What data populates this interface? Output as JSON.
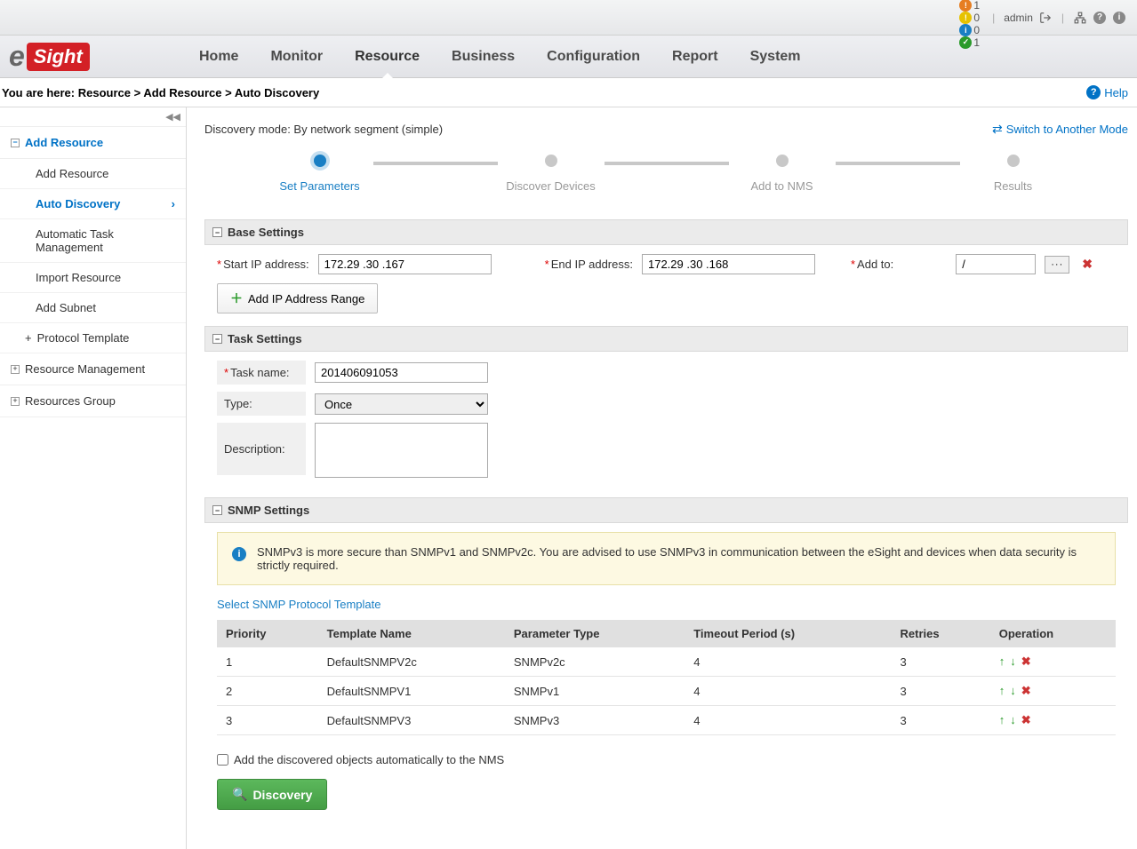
{
  "topbar": {
    "statuses": [
      {
        "color": "#d43f3a",
        "icon": "⟳",
        "count": "1"
      },
      {
        "color": "#e67e22",
        "icon": "!",
        "count": "1"
      },
      {
        "color": "#e6c200",
        "icon": "!",
        "count": "0"
      },
      {
        "color": "#197fc4",
        "icon": "i",
        "count": "0"
      },
      {
        "color": "#2a9a2a",
        "icon": "✓",
        "count": "1"
      }
    ],
    "user": "admin"
  },
  "nav": [
    "Home",
    "Monitor",
    "Resource",
    "Business",
    "Configuration",
    "Report",
    "System"
  ],
  "breadcrumb": {
    "prefix": "You are here:",
    "path1": "Resource",
    "path2": "Add Resource",
    "path3": "Auto Discovery",
    "help": "Help"
  },
  "sidebar": {
    "add_resource": "Add Resource",
    "add_resource_sub": "Add Resource",
    "auto_discovery": "Auto Discovery",
    "auto_task": "Automatic Task Management",
    "import_resource": "Import Resource",
    "add_subnet": "Add Subnet",
    "protocol_template": "Protocol Template",
    "resource_management": "Resource Management",
    "resources_group": "Resources Group"
  },
  "mode": {
    "label": "Discovery mode: By network segment (simple)",
    "switch": "Switch to Another Mode"
  },
  "wizard": [
    "Set Parameters",
    "Discover Devices",
    "Add to NMS",
    "Results"
  ],
  "base": {
    "header": "Base Settings",
    "start_ip_label": "Start IP address:",
    "start_ip": "172.29 .30 .167",
    "end_ip_label": "End IP address:",
    "end_ip": "172.29 .30 .168",
    "add_to_label": "Add to:",
    "add_to": "/",
    "add_range": "Add IP Address Range"
  },
  "task": {
    "header": "Task Settings",
    "name_label": "Task name:",
    "name": "201406091053",
    "type_label": "Type:",
    "type": "Once",
    "desc_label": "Description:"
  },
  "snmp": {
    "header": "SNMP Settings",
    "info": "SNMPv3 is more secure than SNMPv1 and SNMPv2c. You are advised to use SNMPv3 in communication between the eSight and devices when data security is strictly required.",
    "select_link": "Select SNMP Protocol Template",
    "columns": [
      "Priority",
      "Template Name",
      "Parameter Type",
      "Timeout Period (s)",
      "Retries",
      "Operation"
    ],
    "rows": [
      {
        "priority": "1",
        "name": "DefaultSNMPV2c",
        "type": "SNMPv2c",
        "timeout": "4",
        "retries": "3"
      },
      {
        "priority": "2",
        "name": "DefaultSNMPV1",
        "type": "SNMPv1",
        "timeout": "4",
        "retries": "3"
      },
      {
        "priority": "3",
        "name": "DefaultSNMPV3",
        "type": "SNMPv3",
        "timeout": "4",
        "retries": "3"
      }
    ]
  },
  "footer": {
    "auto_add": "Add the discovered objects automatically to the NMS",
    "discovery": "Discovery"
  }
}
